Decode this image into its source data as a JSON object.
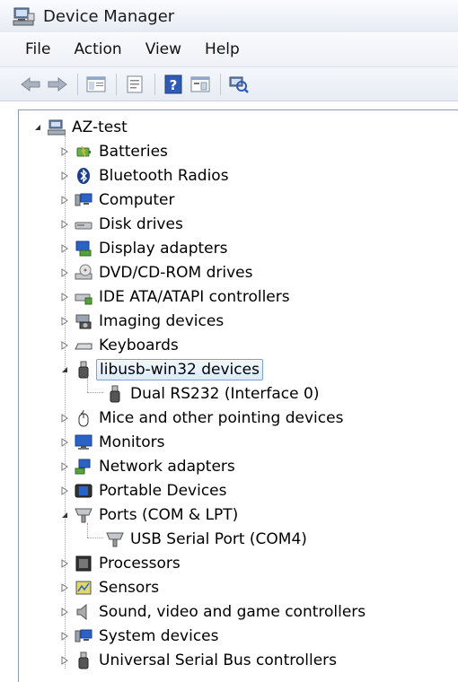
{
  "window": {
    "title": "Device Manager"
  },
  "menu": {
    "items": [
      "File",
      "Action",
      "View",
      "Help"
    ]
  },
  "toolbar": {
    "buttons": [
      "back-arrow-icon",
      "forward-arrow-icon",
      "show-hide-tree-icon",
      "properties-icon",
      "help-icon",
      "run-icon",
      "scan-hardware-icon"
    ]
  },
  "tree": {
    "root": "AZ-test",
    "items": [
      {
        "label": "Batteries",
        "icon": "battery-icon",
        "expanded": false
      },
      {
        "label": "Bluetooth Radios",
        "icon": "bluetooth-icon",
        "expanded": false
      },
      {
        "label": "Computer",
        "icon": "computer-icon",
        "expanded": false
      },
      {
        "label": "Disk drives",
        "icon": "disk-drive-icon",
        "expanded": false
      },
      {
        "label": "Display adapters",
        "icon": "display-adapter-icon",
        "expanded": false
      },
      {
        "label": "DVD/CD-ROM drives",
        "icon": "dvd-drive-icon",
        "expanded": false
      },
      {
        "label": "IDE ATA/ATAPI controllers",
        "icon": "ide-controller-icon",
        "expanded": false
      },
      {
        "label": "Imaging devices",
        "icon": "camera-icon",
        "expanded": false
      },
      {
        "label": "Keyboards",
        "icon": "keyboard-icon",
        "expanded": false
      },
      {
        "label": "libusb-win32 devices",
        "icon": "usb-plug-icon",
        "expanded": true,
        "selected": true,
        "children": [
          "Dual RS232 (Interface 0)"
        ]
      },
      {
        "label": "Mice and other pointing devices",
        "icon": "mouse-icon",
        "expanded": false
      },
      {
        "label": "Monitors",
        "icon": "monitor-icon",
        "expanded": false
      },
      {
        "label": "Network adapters",
        "icon": "network-icon",
        "expanded": false
      },
      {
        "label": "Portable Devices",
        "icon": "portable-device-icon",
        "expanded": false
      },
      {
        "label": "Ports (COM & LPT)",
        "icon": "port-icon",
        "expanded": true,
        "children": [
          "USB Serial Port (COM4)"
        ]
      },
      {
        "label": "Processors",
        "icon": "processor-icon",
        "expanded": false
      },
      {
        "label": "Sensors",
        "icon": "sensor-icon",
        "expanded": false
      },
      {
        "label": "Sound, video and game controllers",
        "icon": "speaker-icon",
        "expanded": false
      },
      {
        "label": "System devices",
        "icon": "system-device-icon",
        "expanded": false
      },
      {
        "label": "Universal Serial Bus controllers",
        "icon": "usb-plug-icon",
        "expanded": false
      }
    ]
  }
}
